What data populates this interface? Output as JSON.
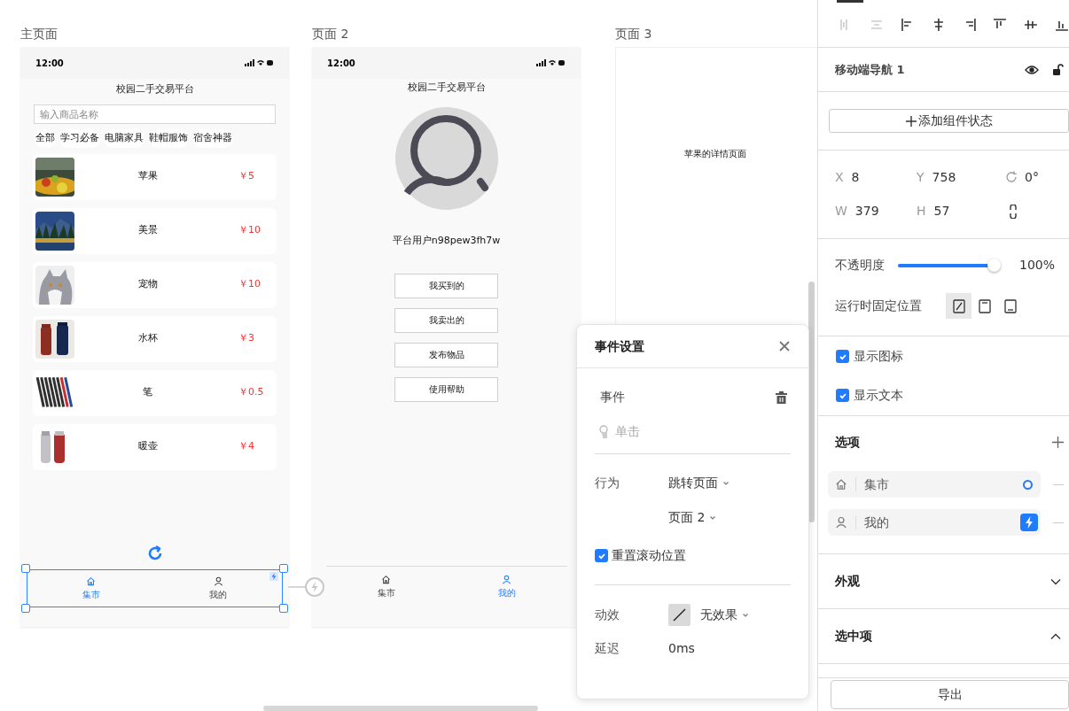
{
  "canvas": {
    "artboards": [
      {
        "kind": "market",
        "label": "主页面",
        "time": "12:00",
        "title": "校园二手交易平台",
        "search": {
          "placeholder": "输入商品名称"
        },
        "categories": [
          "全部",
          "学习必备",
          "电脑家具",
          "鞋帽服饰",
          "宿舍神器"
        ],
        "products": [
          {
            "name": "苹果",
            "price": "￥5"
          },
          {
            "name": "美景",
            "price": "￥10"
          },
          {
            "name": "宠物",
            "price": "￥10"
          },
          {
            "name": "水杯",
            "price": "￥3"
          },
          {
            "name": "笔",
            "price": "￥0.5"
          },
          {
            "name": "暖壶",
            "price": "￥4"
          }
        ],
        "nav_tabs": [
          {
            "label": "集市",
            "selected": true
          },
          {
            "label": "我的",
            "selected": false
          }
        ]
      },
      {
        "kind": "profile",
        "label": "页面 2",
        "time": "12:00",
        "title": "校园二手交易平台",
        "username": "平台用户n98pew3fh7w",
        "buttons": [
          "我买到的",
          "我卖出的",
          "发布物品",
          "使用帮助"
        ],
        "nav_tabs": [
          {
            "label": "集市",
            "selected": false
          },
          {
            "label": "我的",
            "selected": true
          }
        ]
      },
      {
        "kind": "detail",
        "label": "页面 3",
        "text": "苹果的详情页面"
      }
    ]
  },
  "event_dialog": {
    "title": "事件设置",
    "event_label": "事件",
    "trigger": "单击",
    "action_label": "行为",
    "action": "跳转页面",
    "target": "页面 2",
    "reset_scroll": {
      "label": "重置滚动位置",
      "checked": true
    },
    "effect_label": "动效",
    "effect": "无效果",
    "delay_label": "延迟",
    "delay": "0ms"
  },
  "panel": {
    "align_tools": [
      {
        "disabled": true
      },
      {
        "disabled": true
      },
      {
        "disabled": false
      },
      {
        "disabled": false
      },
      {
        "disabled": false
      },
      {
        "disabled": false
      },
      {
        "disabled": false
      },
      {
        "disabled": false
      }
    ],
    "component_name": "移动端导航 1",
    "add_state": "添加组件状态",
    "geometry": [
      {
        "label": "X",
        "value": "8"
      },
      {
        "label": "Y",
        "value": "758"
      },
      {
        "label": "W",
        "value": "379"
      },
      {
        "label": "H",
        "value": "57"
      }
    ],
    "rotation": "0°",
    "opacity": {
      "label": "不透明度",
      "level": 1,
      "reading": "100%"
    },
    "fixed_position": {
      "label": "运行时固定位置",
      "options": [
        {
          "selected": true
        },
        {
          "selected": false
        },
        {
          "selected": false
        }
      ]
    },
    "checkboxes": [
      {
        "label": "显示图标",
        "checked": true
      },
      {
        "label": "显示文本",
        "checked": true
      }
    ],
    "options": {
      "title": "选项",
      "items": [
        {
          "label": "集市",
          "selected": true,
          "linked": false
        },
        {
          "label": "我的",
          "selected": false,
          "linked": true
        }
      ]
    },
    "sections": [
      {
        "title": "外观",
        "expanded": false
      },
      {
        "title": "选中项",
        "expanded": true
      }
    ],
    "export": "导出"
  }
}
